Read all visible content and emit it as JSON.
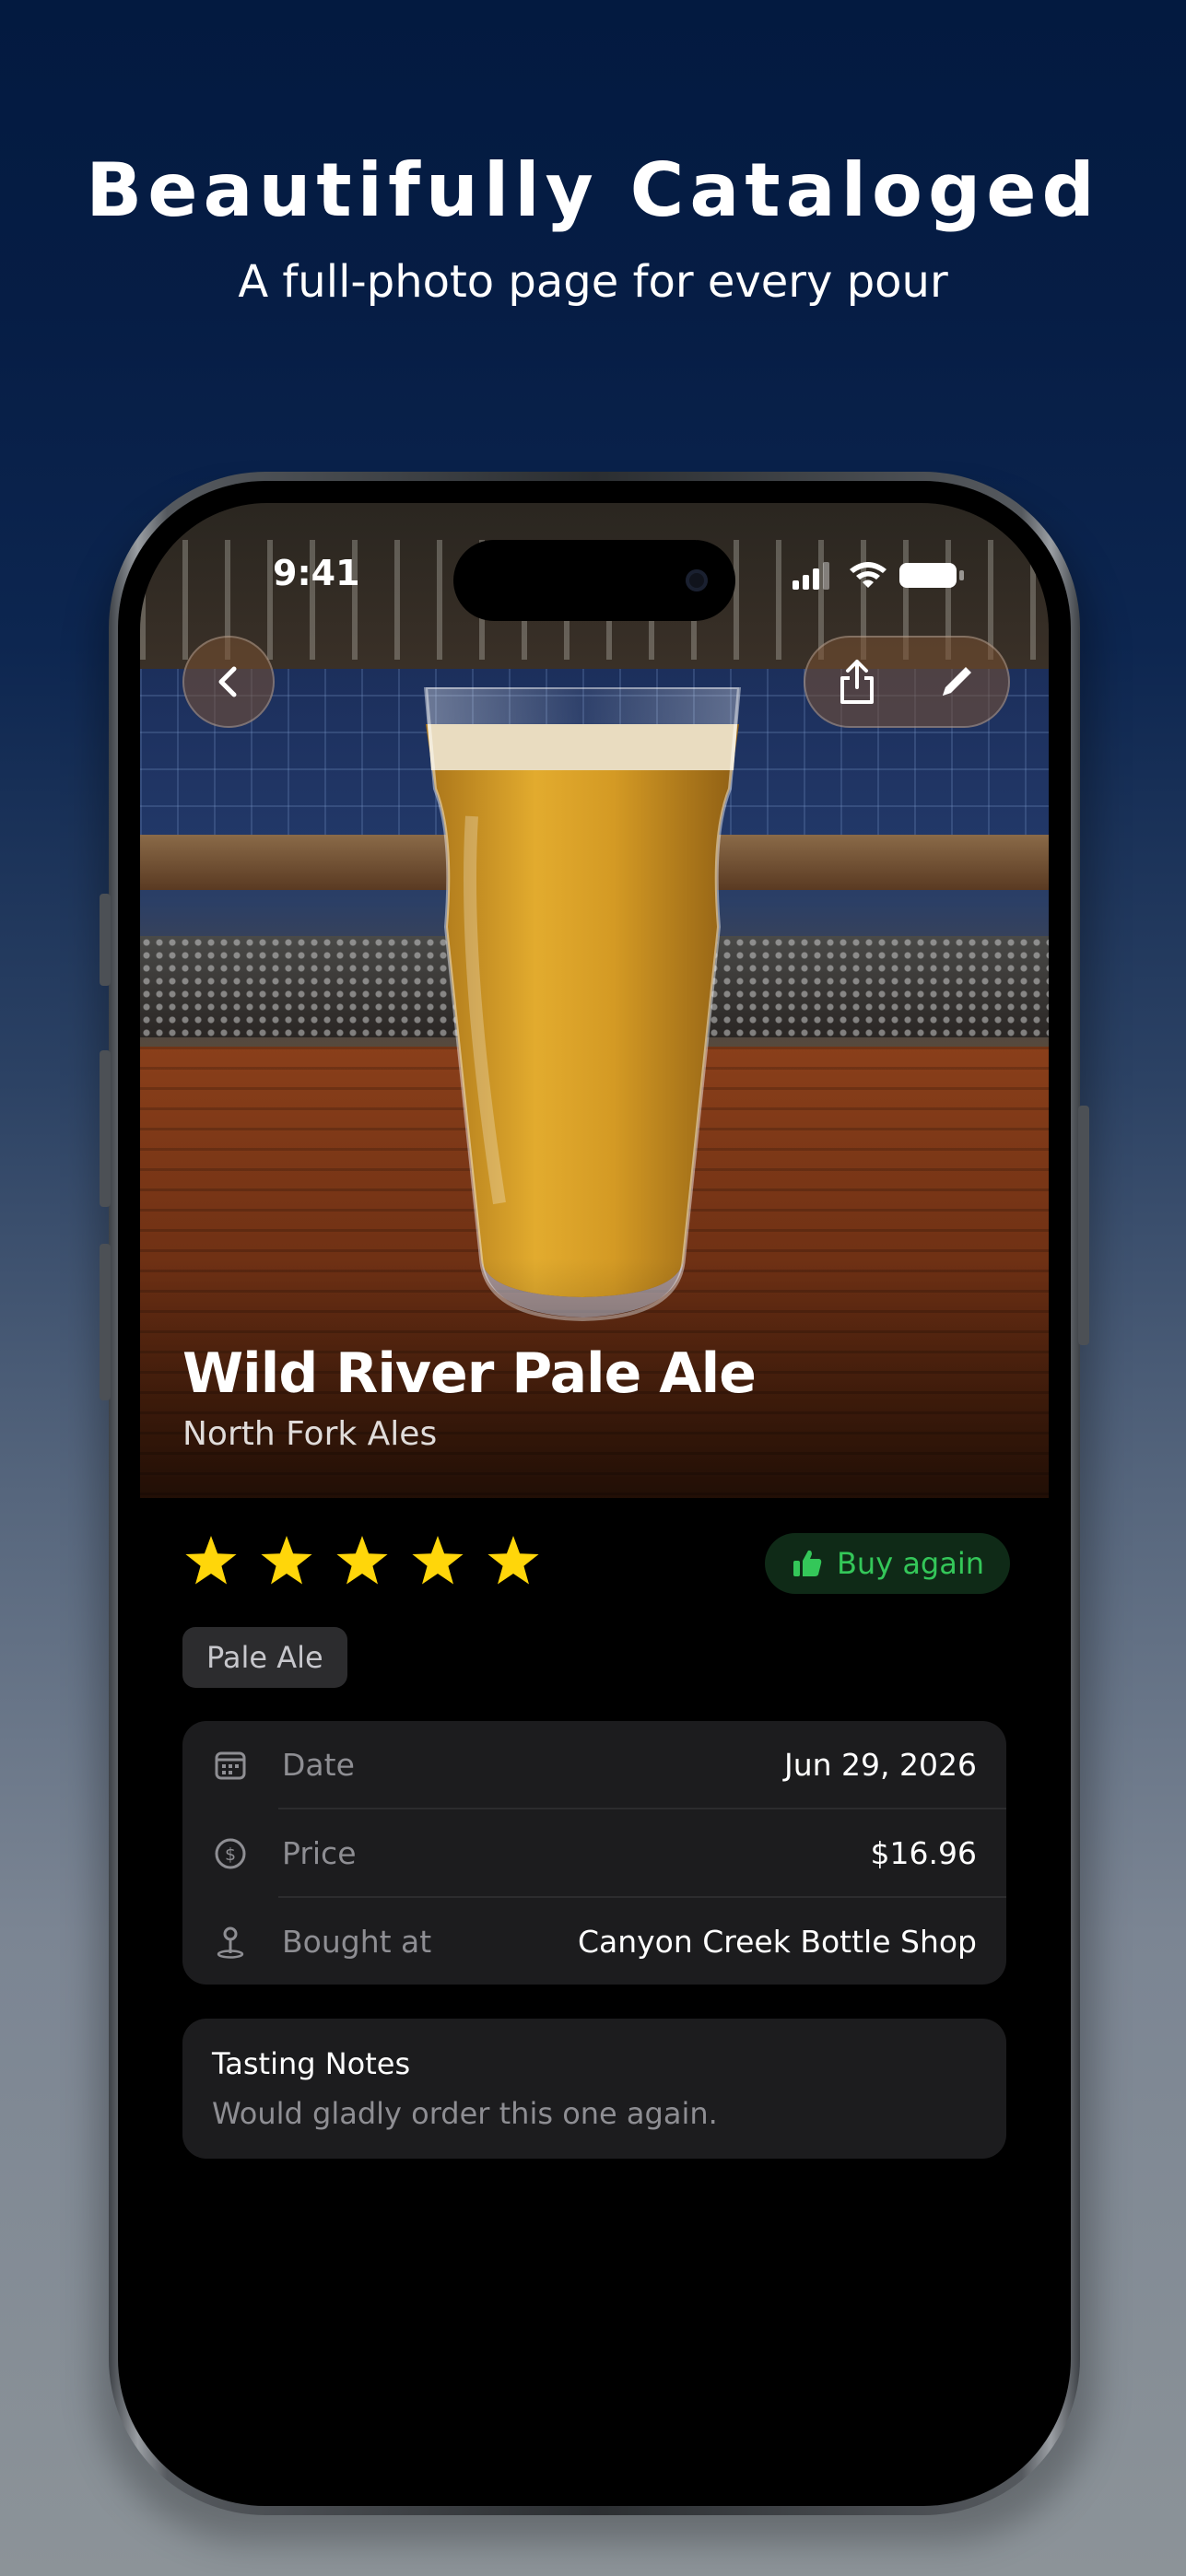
{
  "promo": {
    "headline": "Beautifully Cataloged",
    "subheadline": "A full-photo page for every pour"
  },
  "status_bar": {
    "time": "9:41"
  },
  "nav": {
    "back_icon": "chevron-left-icon",
    "share_icon": "share-icon",
    "edit_icon": "pencil-icon"
  },
  "beer": {
    "name": "Wild River Pale Ale",
    "brewery": "North Fork Ales",
    "rating": 5,
    "rating_max": 5,
    "buy_again_label": "Buy again",
    "style": "Pale Ale"
  },
  "details": [
    {
      "icon": "calendar-icon",
      "label": "Date",
      "value": "Jun 29, 2026"
    },
    {
      "icon": "dollar-circle-icon",
      "label": "Price",
      "value": "$16.96"
    },
    {
      "icon": "location-pin-icon",
      "label": "Bought at",
      "value": "Canyon Creek Bottle Shop"
    }
  ],
  "notes": {
    "title": "Tasting Notes",
    "body": "Would gladly order this one again."
  },
  "colors": {
    "accent_green": "#34c759",
    "star_yellow": "#ffd60a",
    "card_bg": "#1c1c1e"
  }
}
